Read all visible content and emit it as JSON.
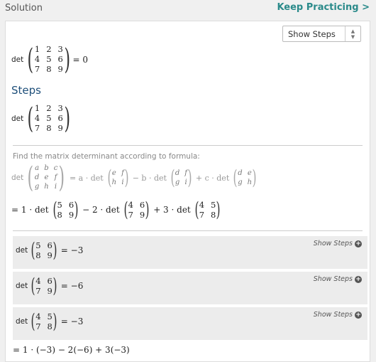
{
  "header": {
    "title": "Solution",
    "keep_practicing": "Keep Practicing >"
  },
  "controls": {
    "show_steps_select": "Show Steps"
  },
  "result_line": {
    "det": "det",
    "matrix": [
      [
        "1",
        "2",
        "3"
      ],
      [
        "4",
        "5",
        "6"
      ],
      [
        "7",
        "8",
        "9"
      ]
    ],
    "result": "= 0"
  },
  "steps_heading": "Steps",
  "steps_matrix": {
    "det": "det",
    "matrix": [
      [
        "1",
        "2",
        "3"
      ],
      [
        "4",
        "5",
        "6"
      ],
      [
        "7",
        "8",
        "9"
      ]
    ]
  },
  "formula": {
    "caption": "Find the matrix determinant according to formula:",
    "det": "det",
    "generic": [
      [
        "a",
        "b",
        "c"
      ],
      [
        "d",
        "e",
        "f"
      ],
      [
        "g",
        "h",
        "i"
      ]
    ],
    "eq": "= a · det",
    "m1": [
      [
        "e",
        "f"
      ],
      [
        "h",
        "i"
      ]
    ],
    "minus_b": "− b · det",
    "m2": [
      [
        "d",
        "f"
      ],
      [
        "g",
        "i"
      ]
    ],
    "plus_c": "+ c · det",
    "m3": [
      [
        "d",
        "e"
      ],
      [
        "g",
        "h"
      ]
    ]
  },
  "expansion": {
    "eq1": "= 1 · det",
    "m1": [
      [
        "5",
        "6"
      ],
      [
        "8",
        "9"
      ]
    ],
    "minus2": "− 2 · det",
    "m2": [
      [
        "4",
        "6"
      ],
      [
        "7",
        "9"
      ]
    ],
    "plus3": "+ 3 · det",
    "m3": [
      [
        "4",
        "5"
      ],
      [
        "7",
        "8"
      ]
    ]
  },
  "substeps": [
    {
      "det": "det",
      "matrix": [
        [
          "5",
          "6"
        ],
        [
          "8",
          "9"
        ]
      ],
      "result": "= −3",
      "link": "Show Steps"
    },
    {
      "det": "det",
      "matrix": [
        [
          "4",
          "6"
        ],
        [
          "7",
          "9"
        ]
      ],
      "result": "= −6",
      "link": "Show Steps"
    },
    {
      "det": "det",
      "matrix": [
        [
          "4",
          "5"
        ],
        [
          "7",
          "8"
        ]
      ],
      "result": "= −3",
      "link": "Show Steps"
    }
  ],
  "final_line": "= 1 · (−3) − 2(−6) + 3(−3)"
}
